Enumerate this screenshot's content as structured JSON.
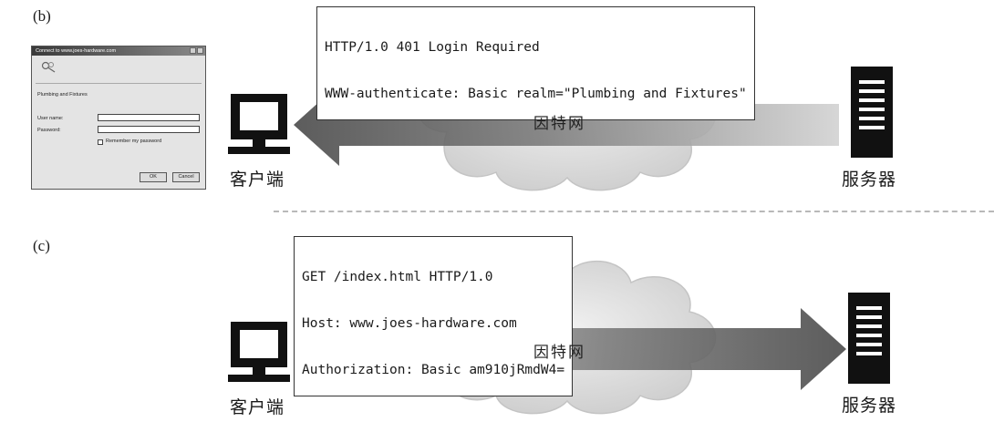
{
  "panels": [
    {
      "label": "(b)",
      "message_lines": [
        "HTTP/1.0 401 Login Required",
        "WWW-authenticate: Basic realm=\"Plumbing and Fixtures\""
      ],
      "network_label": "因特网",
      "client_label": "客户端",
      "server_label": "服务器",
      "arrow_direction": "server-to-client"
    },
    {
      "label": "(c)",
      "message_lines": [
        "GET /index.html HTTP/1.0",
        "Host: www.joes-hardware.com",
        "Authorization: Basic am910jRmdW4="
      ],
      "network_label": "因特网",
      "client_label": "客户端",
      "server_label": "服务器",
      "arrow_direction": "client-to-server"
    }
  ],
  "login_dialog": {
    "title": "Connect to www.joes-hardware.com",
    "realm": "Plumbing and Fixtures",
    "user_label": "User name:",
    "password_label": "Password:",
    "user_value": "",
    "password_value": "",
    "remember_label": "Remember my password",
    "ok_label": "OK",
    "cancel_label": "Cancel"
  }
}
